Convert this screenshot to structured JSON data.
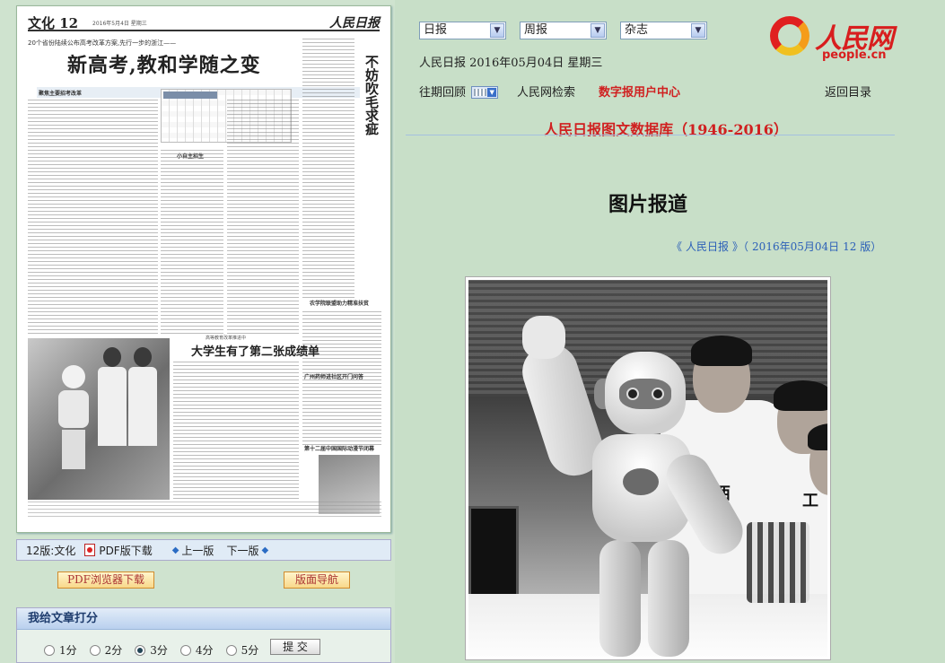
{
  "newspaper_page": {
    "section": "文化 12",
    "date_small": "2016年5月4日 星期三",
    "masthead": "人民日报",
    "kicker": "20个省份陆续公布高考改革方案,先行一步的浙江——",
    "headline": "新高考,教和学随之变",
    "vertical_headline": "不妨吹毛求疵",
    "subhead_1": "聚焦主要招考改革",
    "subhead_2": "小自主招生",
    "second_headline": "大学生有了第二张成绩单",
    "second_kicker": "高等教育改革推进中",
    "box_headline_1": "农学院联盟助力精准扶贫",
    "box_headline_2": "广州药师进社区开门问答",
    "box_headline_3": "第十二届中国国际动漫节闭幕"
  },
  "toolbar": {
    "page_label": "12版:文化",
    "pdf_label": "PDF版下载",
    "prev_label": "上一版",
    "next_label": "下一版"
  },
  "buttons": {
    "pdf_browser": "PDF浏览器下载",
    "page_nav": "版面导航"
  },
  "rating": {
    "title": "我给文章打分",
    "options": [
      "1分",
      "2分",
      "3分",
      "4分",
      "5分"
    ],
    "selected_index": 2,
    "submit": "提  交"
  },
  "selects": {
    "daily": "日报",
    "weekly": "周报",
    "magazine": "杂志"
  },
  "date_line": "人民日报  2016年05月04日  星期三",
  "nav": {
    "history": "往期回顾",
    "search": "人民网检索",
    "user_center": "数字报用户中心",
    "back": "返回目录"
  },
  "logo": {
    "cn": "人民网",
    "en": "people.cn"
  },
  "db_title": "人民日报图文数据库（1946-2016）",
  "article_title": "图片报道",
  "source": {
    "open": "《",
    "paper": "人民日报",
    "close": "》（",
    "date": "2016年05月04日",
    "edition": "12 版）"
  },
  "photo": {
    "shirt_label_1": "工西",
    "shirt_label_2": "工"
  },
  "colors": {
    "accent_red": "#d02020",
    "link_blue": "#2b5fb8",
    "background_green": "#c8dfc8"
  }
}
